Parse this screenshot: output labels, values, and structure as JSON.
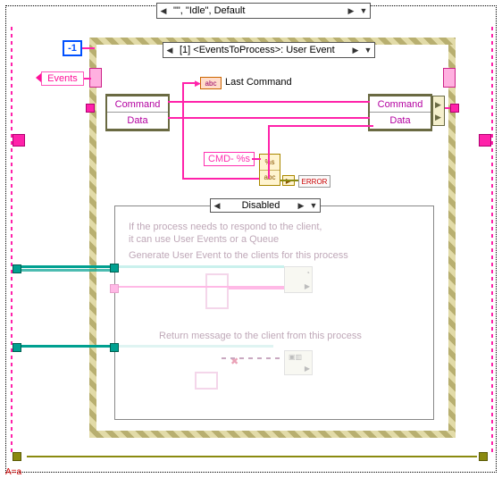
{
  "outer_case": {
    "label": "\"\", \"Idle\", Default"
  },
  "minus_one": "-1",
  "events_terminal": "Events",
  "event_case": {
    "label": "[1] <EventsToProcess>: User Event"
  },
  "last_command": {
    "type": "abc",
    "label": "Last Command"
  },
  "unbundle_left": {
    "rows": [
      "Command",
      "Data"
    ]
  },
  "bundle_right": {
    "rows": [
      "Command",
      "Data"
    ]
  },
  "cmd_format": "CMD- %s",
  "format_node": {
    "top": "%s",
    "bottom": "abc"
  },
  "error_wire": "ERROR",
  "disabled": {
    "selector": "Disabled",
    "comment1": "If the process needs to respond to the client,",
    "comment2": "it can use User Events or a Queue",
    "gen_label": "Generate User Event to the clients for this process",
    "ret_label": "Return message to the client from this process"
  },
  "footer": "A=a"
}
